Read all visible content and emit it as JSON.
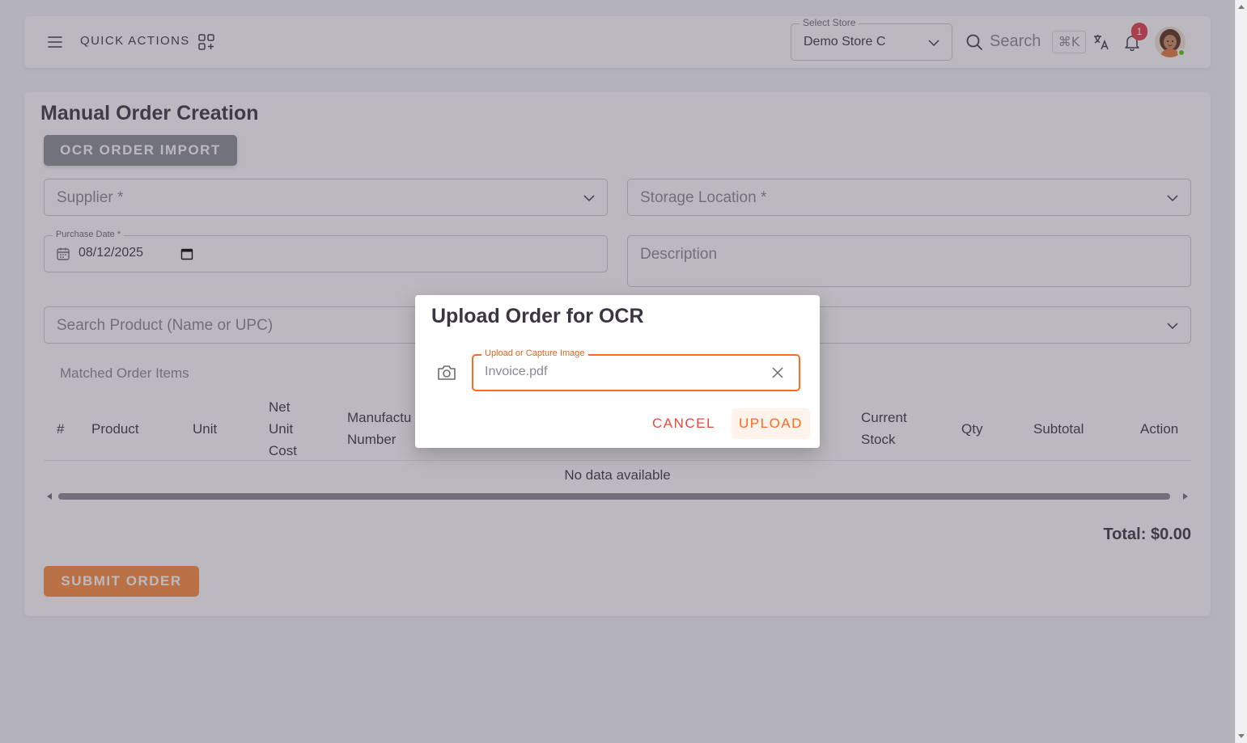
{
  "topbar": {
    "quick_actions_label": "QUICK ACTIONS",
    "store_select": {
      "legend": "Select Store",
      "value": "Demo Store C"
    },
    "search": {
      "placeholder": "Search",
      "shortcut": "⌘K"
    },
    "notifications": {
      "count": "1"
    }
  },
  "main": {
    "title": "Manual Order Creation",
    "ocr_button": "OCR ORDER IMPORT",
    "supplier": {
      "placeholder": "Supplier *"
    },
    "storage_location": {
      "placeholder": "Storage Location *"
    },
    "purchase_date": {
      "legend": "Purchase Date *",
      "value": "08/12/2025"
    },
    "description": {
      "placeholder": "Description"
    },
    "search_product": {
      "placeholder": "Search Product (Name or UPC)"
    },
    "matched_label": "Matched Order Items",
    "table": {
      "headers": [
        "#",
        "Product",
        "Unit",
        "Net\nUnit\nCost",
        "Manufactu\nNumber",
        "Current\nStock",
        "Qty",
        "Subtotal",
        "Action"
      ],
      "empty_text": "No data available"
    },
    "total": "Total: $0.00",
    "submit_button": "SUBMIT ORDER"
  },
  "dialog": {
    "title": "Upload Order for OCR",
    "field_legend": "Upload or Capture Image",
    "field_value": "Invoice.pdf",
    "cancel_label": "CANCEL",
    "upload_label": "UPLOAD"
  },
  "colors": {
    "primary": "#ff6a1f",
    "error": "#e54b3c",
    "badge": "#e23b4a",
    "overlay": "rgba(76,72,86,0.38)"
  }
}
